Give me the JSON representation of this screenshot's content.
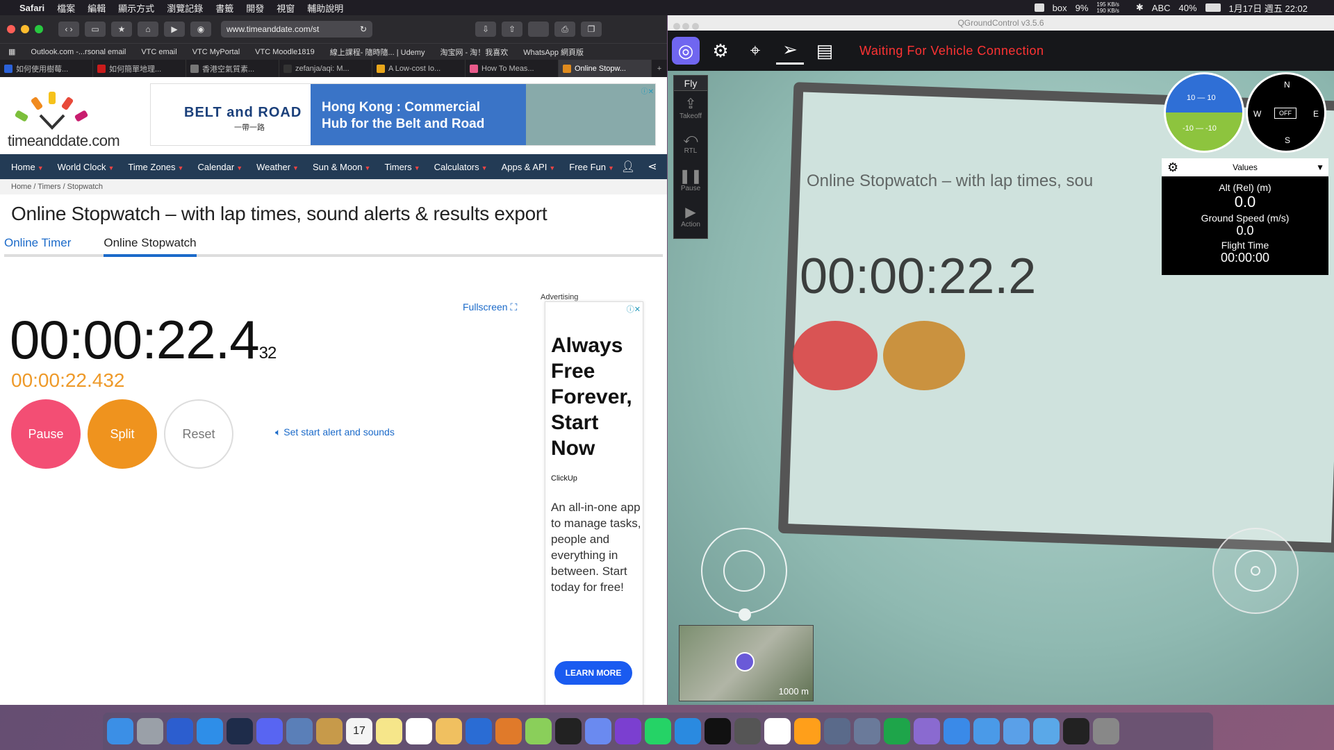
{
  "menubar": {
    "app": "Safari",
    "items": [
      "檔案",
      "編輯",
      "顯示方式",
      "瀏覽記錄",
      "書籤",
      "開發",
      "視窗",
      "輔助說明"
    ],
    "battery_pct": "9%",
    "net_up": "195 KB/s",
    "net_down": "190 KB/s",
    "wifi_pct": "40%",
    "input": "ABC",
    "date_time": "1月17日 週五 22:02",
    "box_label": "box"
  },
  "safari": {
    "url": "www.timeanddate.com/st",
    "favorites": [
      "Outlook.com -...rsonal email",
      "VTC email",
      "VTC MyPortal",
      "VTC Moodle1819",
      "線上課程- 隨時隨... | Udemy",
      "淘宝网 - 淘！我喜欢",
      "WhatsApp 網頁版"
    ],
    "tabs": [
      "如何使用樹莓...",
      "如何簡單地理...",
      "香港空氣質素...",
      "zefanja/aqi: M...",
      "A Low-cost Io...",
      "How To Meas...",
      "Online Stopw..."
    ],
    "tab_colors": [
      "#2b61d8",
      "#c91b1b",
      "#777777",
      "#333333",
      "#e8a61b",
      "#e85a8a",
      "#e08b1e"
    ],
    "active_tab": 6
  },
  "site": {
    "logo": "timeanddate.com",
    "banner": {
      "brand": "BELT and ROAD",
      "brand_sub": "一帶一路",
      "headline_1": "Hong Kong : Commercial",
      "headline_2": "Hub for the Belt and Road"
    },
    "nav": [
      "Home",
      "World Clock",
      "Time Zones",
      "Calendar",
      "Weather",
      "Sun & Moon",
      "Timers",
      "Calculators",
      "Apps & API",
      "Free Fun"
    ],
    "breadcrumb": "Home /   Timers /   Stopwatch",
    "title": "Online Stopwatch – with lap times, sound alerts & results export",
    "subtabs": [
      "Online Timer",
      "Online Stopwatch"
    ],
    "fullscreen": "Fullscreen",
    "time_main": "00:00:22.4",
    "time_ms": "32",
    "time_full": "00:00:22.432",
    "buttons": {
      "pause": "Pause",
      "split": "Split",
      "reset": "Reset"
    },
    "alert_link": "Set start alert and sounds",
    "advertising": "Advertising",
    "ad": {
      "headline": "Always Free Forever, Start Now",
      "brand": "ClickUp",
      "body": "An all-in-one app to manage tasks, people and everything in between. Start today for free!",
      "cta": "LEARN MORE"
    }
  },
  "qgc": {
    "window_title": "QGroundControl v3.5.6",
    "status": "Waiting For Vehicle Connection",
    "fly_header": "Fly",
    "fly_buttons": [
      "Takeoff",
      "RTL",
      "Pause",
      "Action"
    ],
    "attitude": {
      "pitch_top": "10 — 10",
      "pitch_bottom": "-10 — -10"
    },
    "compass": {
      "n": "N",
      "e": "E",
      "s": "S",
      "w": "W",
      "center": "OFF"
    },
    "values_header": "Values",
    "values": [
      {
        "label": "Alt (Rel) (m)",
        "value": "0.0"
      },
      {
        "label": "Ground Speed (m/s)",
        "value": "0.0"
      },
      {
        "label": "Flight Time",
        "value": "00:00:00"
      }
    ],
    "map_scale": "1000 m",
    "video": {
      "title": "Online Stopwatch – with lap times, sou",
      "time": "00:00:22.2"
    }
  },
  "dock": {
    "calendar_day": "17",
    "colors": [
      "#3b8fe6",
      "#9aa0a8",
      "#2c5ecf",
      "#2e8ee8",
      "#1e2c4a",
      "#5865f2",
      "#5a7fb8",
      "#c79a4a",
      "#f4f4f4",
      "#f6e68a",
      "#ffffff",
      "#f0c060",
      "#2a6cd4",
      "#e07a2a",
      "#8acf5a",
      "#222222",
      "#6a8af0",
      "#7b3fd0",
      "#25d366",
      "#2a8ae0",
      "#111111",
      "#555555",
      "#ffffff",
      "#ff9f1a",
      "#5a6a8a",
      "#6a7a9a",
      "#1ea54a",
      "#8a6ad0",
      "#3a8ae8",
      "#4a9ae8",
      "#5aa0e8",
      "#5aa8e8",
      "#222222",
      "#888888"
    ]
  }
}
